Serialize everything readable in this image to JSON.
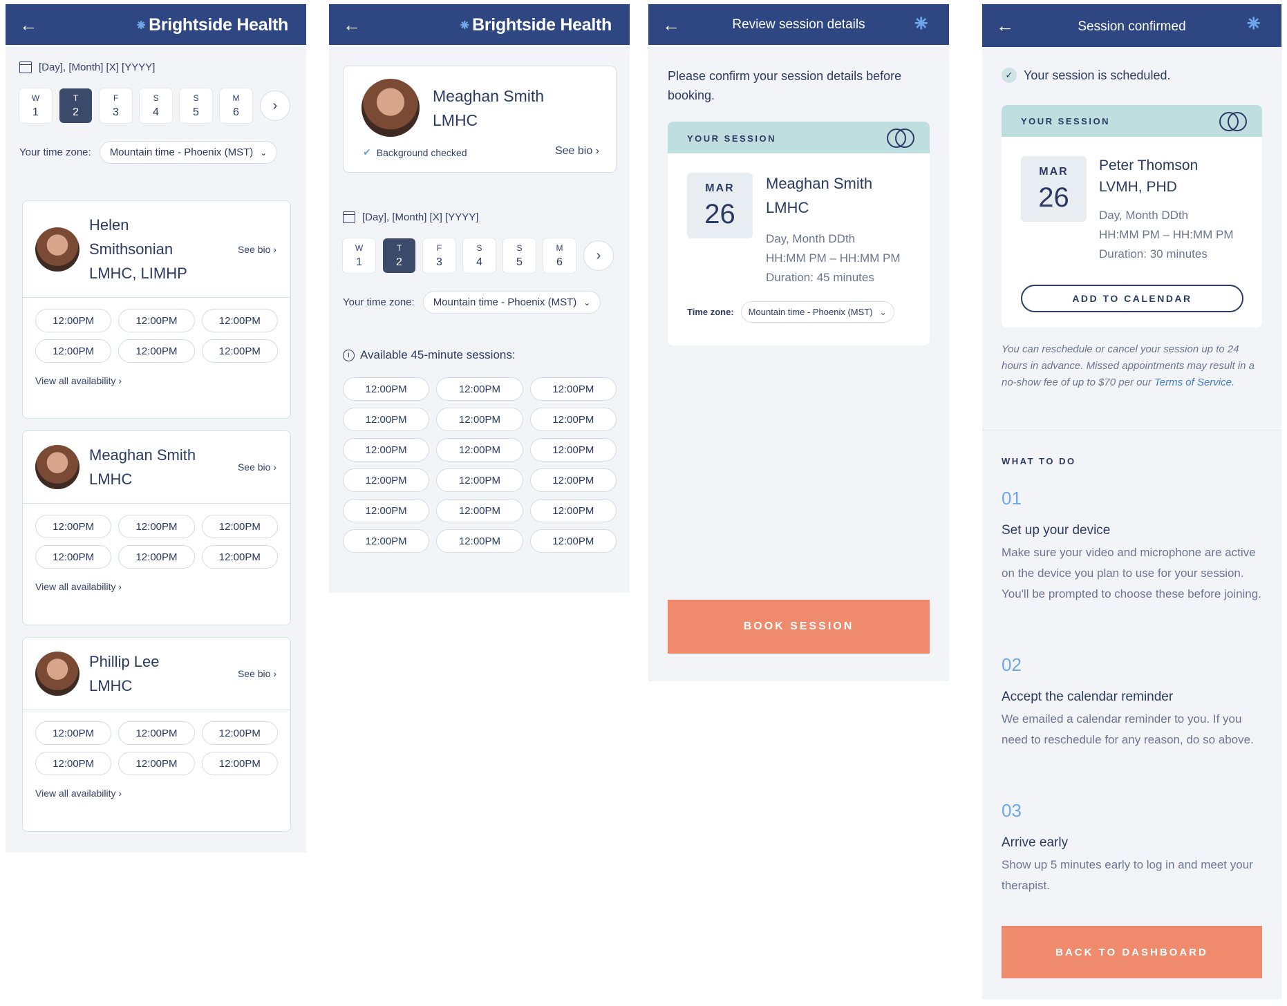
{
  "brand": {
    "name": "Brightside Health"
  },
  "common": {
    "date_text": "[Day], [Month] [X] [YYYY]",
    "tz_label": "Your time zone:",
    "tz_value": "Mountain time - Phoenix (MST)",
    "days": [
      {
        "letter": "W",
        "num": "1"
      },
      {
        "letter": "T",
        "num": "2"
      },
      {
        "letter": "F",
        "num": "3"
      },
      {
        "letter": "S",
        "num": "4"
      },
      {
        "letter": "S",
        "num": "5"
      },
      {
        "letter": "M",
        "num": "6"
      }
    ],
    "slot": "12:00PM",
    "see_bio": "See bio",
    "view_all": "View all availability"
  },
  "screen1": {
    "therapists": [
      {
        "name_lines": [
          "Helen",
          "Smithsonian",
          "LMHC, LIMHP"
        ]
      },
      {
        "name_lines": [
          "Meaghan Smith",
          "LMHC"
        ]
      },
      {
        "name_lines": [
          "Phillip Lee",
          "LMHC"
        ]
      }
    ]
  },
  "screen2": {
    "name": "Meaghan Smith",
    "cred": "LMHC",
    "bg_checked": "Background checked",
    "available_label": "Available 45-minute sessions:"
  },
  "screen3": {
    "title": "Review session details",
    "intro": "Please confirm your session details before booking.",
    "your_session": "YOUR SESSION",
    "month": "MAR",
    "day": "26",
    "name": "Meaghan Smith",
    "cred": "LMHC",
    "date_line": "Day, Month DDth",
    "time_line": "HH:MM PM – HH:MM PM",
    "duration": "Duration: 45 minutes",
    "tz_label": "Time zone:",
    "tz_value": "Mountain time - Phoenix (MST)",
    "book": "BOOK SESSION"
  },
  "screen4": {
    "title": "Session confirmed",
    "scheduled": "Your session is scheduled.",
    "your_session": "YOUR SESSION",
    "month": "MAR",
    "day": "26",
    "name": "Peter Thomson",
    "cred": "LVMH, PHD",
    "date_line": "Day, Month DDth",
    "time_line": "HH:MM PM – HH:MM PM",
    "duration": "Duration: 30 minutes",
    "add_cal": "ADD TO CALENDAR",
    "policy": "You can reschedule or cancel your session up to 24 hours in advance. Missed appointments may result in a no-show fee of up to $70 per our",
    "tos": "Terms of Service.",
    "what_to_do": "WHAT TO DO",
    "steps": [
      {
        "num": "01",
        "title": "Set up your device",
        "body": "Make sure your video and microphone are active on the device you plan to use for your session. You'll be prompted to choose these before joining."
      },
      {
        "num": "02",
        "title": "Accept the calendar reminder",
        "body": "We emailed a calendar reminder to you. If you need to reschedule for any reason, do so above."
      },
      {
        "num": "03",
        "title": "Arrive early",
        "body": "Show up 5 minutes early to log in and meet your therapist."
      }
    ],
    "back_dash": "BACK TO DASHBOARD"
  },
  "colors": {
    "header": "#2e4783",
    "accent_coral": "#ef8a6d",
    "session_band": "#bfdee0",
    "step_num": "#6fa8e8"
  }
}
